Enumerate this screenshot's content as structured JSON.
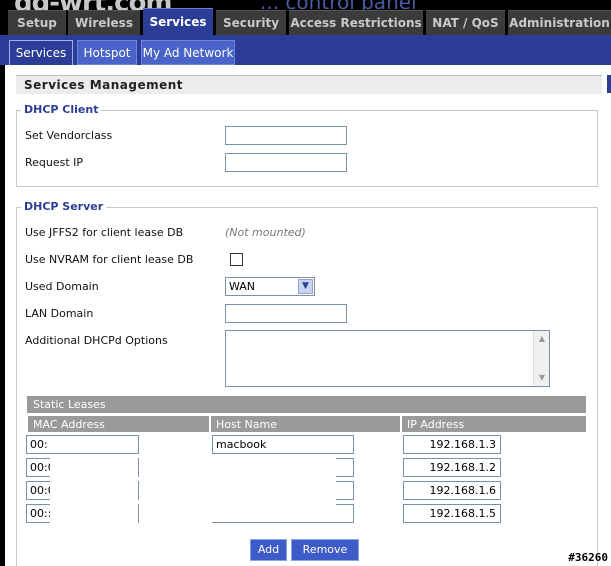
{
  "header": {
    "logo_fragment": "dd-wrt.com",
    "logo_subtitle": "... control panel"
  },
  "main_tabs": [
    {
      "label": "Setup",
      "active": false
    },
    {
      "label": "Wireless",
      "active": false
    },
    {
      "label": "Services",
      "active": true
    },
    {
      "label": "Security",
      "active": false
    },
    {
      "label": "Access Restrictions",
      "active": false
    },
    {
      "label": "NAT / QoS",
      "active": false
    },
    {
      "label": "Administration",
      "active": false
    }
  ],
  "sub_tabs": [
    {
      "label": "Services",
      "active": true
    },
    {
      "label": "Hotspot",
      "active": false
    },
    {
      "label": "My Ad Network",
      "active": false
    }
  ],
  "section_title": "Services Management",
  "dhcp_client": {
    "legend": "DHCP Client",
    "vendorclass_label": "Set Vendorclass",
    "vendorclass_value": "",
    "request_ip_label": "Request IP",
    "request_ip_value": ""
  },
  "dhcp_server": {
    "legend": "DHCP Server",
    "jffs2_label": "Use JFFS2 for client lease DB",
    "jffs2_status": "(Not mounted)",
    "nvram_label": "Use NVRAM for client lease DB",
    "nvram_checked": false,
    "used_domain_label": "Used Domain",
    "used_domain_value": "WAN",
    "lan_domain_label": "LAN Domain",
    "lan_domain_value": "",
    "additional_options_label": "Additional DHCPd Options",
    "additional_options_value": ""
  },
  "static_leases": {
    "title": "Static Leases",
    "columns": [
      "MAC Address",
      "Host Name",
      "IP Address"
    ],
    "rows": [
      {
        "mac": "00:",
        "host": "macbook",
        "ip": "192.168.1.3"
      },
      {
        "mac": "00:0",
        "host": "",
        "ip": "192.168.1.2"
      },
      {
        "mac": "00:0",
        "host": "",
        "ip": "192.168.1.6"
      },
      {
        "mac": "00::",
        "host": "",
        "ip": "192.168.1.5"
      }
    ]
  },
  "buttons": {
    "add": "Add",
    "remove": "Remove"
  },
  "watermark": "#36260",
  "colors": {
    "accent": "#2b3d96",
    "tab_inactive": "#3b3b3b",
    "subtab": "#4a63c8",
    "legend": "#2b3d96"
  }
}
